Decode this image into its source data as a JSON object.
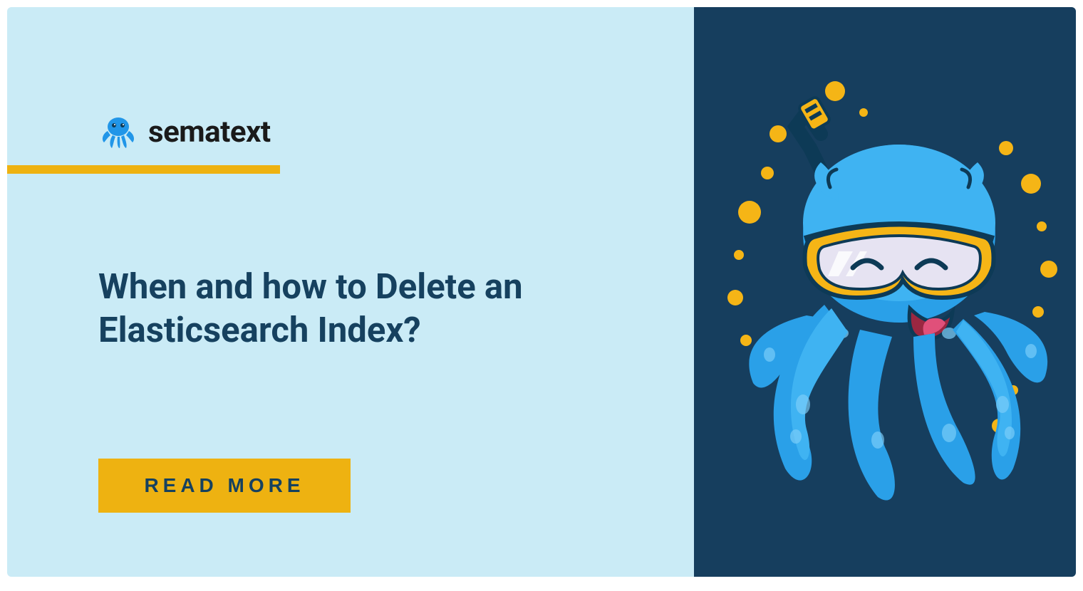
{
  "brand": {
    "name": "sematext"
  },
  "headline": "When and how to Delete an Elasticsearch Index?",
  "cta": {
    "label": "READ MORE"
  },
  "colors": {
    "background_left": "#caebf6",
    "background_right": "#163e5e",
    "accent": "#eeb211",
    "text_primary": "#16415f",
    "brand_blue": "#2196e8"
  }
}
